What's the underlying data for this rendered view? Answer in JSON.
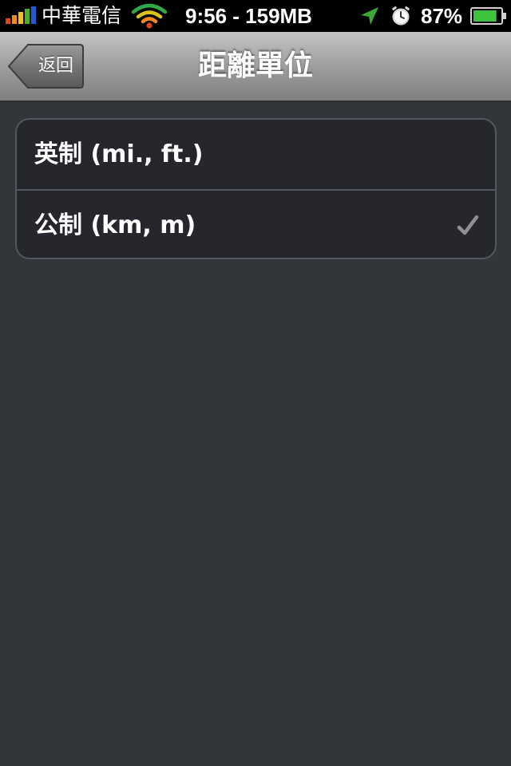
{
  "status_bar": {
    "carrier": "中華電信",
    "time_memory": "9:56 - 159MB",
    "battery_percent": "87%",
    "battery_level": 0.87,
    "icons": [
      "signal-bars-icon",
      "wifi-icon",
      "location-arrow-icon",
      "alarm-clock-icon",
      "battery-icon"
    ]
  },
  "nav": {
    "back_label": "返回",
    "title": "距離單位"
  },
  "options": [
    {
      "label": "英制 (mi., ft.)",
      "selected": false
    },
    {
      "label": "公制 (km, m)",
      "selected": true,
      "indicator": "checkmark-icon"
    }
  ],
  "colors": {
    "background": "#32353a",
    "group_background": "#25272c",
    "separator": "#54575d",
    "status_bar": "#000000"
  }
}
